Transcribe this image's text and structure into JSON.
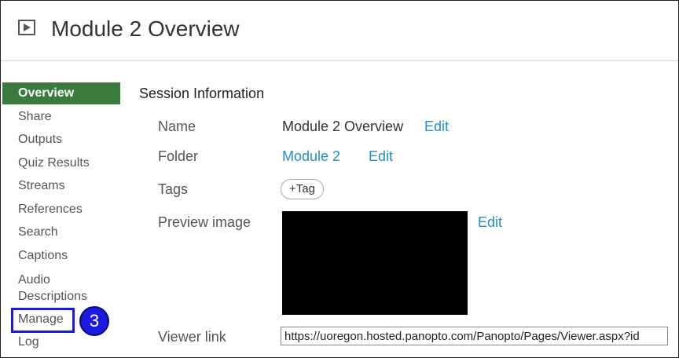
{
  "header": {
    "title": "Module 2 Overview",
    "icon": "video-icon"
  },
  "sidebar": {
    "items": [
      {
        "label": "Overview",
        "active": true
      },
      {
        "label": "Share"
      },
      {
        "label": "Outputs"
      },
      {
        "label": "Quiz Results"
      },
      {
        "label": "Streams"
      },
      {
        "label": "References"
      },
      {
        "label": "Search"
      },
      {
        "label": "Captions"
      },
      {
        "label": "Audio Descriptions"
      },
      {
        "label": "Manage"
      },
      {
        "label": "Log"
      }
    ]
  },
  "annotation": {
    "step": "3",
    "color": "#1a1ae0"
  },
  "session": {
    "title": "Session Information",
    "name_label": "Name",
    "name_value": "Module 2 Overview",
    "folder_label": "Folder",
    "folder_value": "Module 2",
    "tags_label": "Tags",
    "tag_button": "+Tag",
    "preview_label": "Preview image",
    "viewer_label": "Viewer link",
    "viewer_url": "https://uoregon.hosted.panopto.com/Panopto/Pages/Viewer.aspx?id",
    "edit": "Edit"
  },
  "colors": {
    "active_nav": "#3a7a3c",
    "link": "#1f8ec9"
  }
}
